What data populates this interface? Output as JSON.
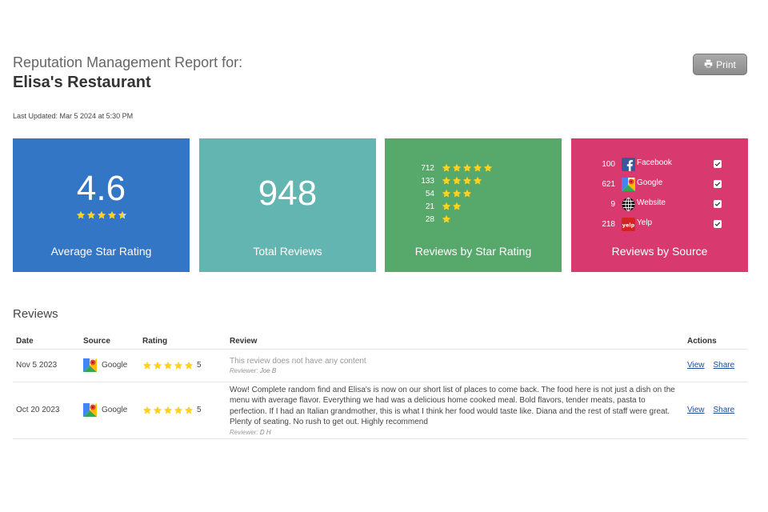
{
  "header": {
    "subtitle": "Reputation Management Report for:",
    "title": "Elisa's Restaurant",
    "print_label": "Print",
    "last_updated": "Last Updated: Mar 5 2024 at 5:30 PM"
  },
  "tiles": {
    "average": {
      "value": "4.6",
      "label": "Average Star Rating",
      "stars": 4.6
    },
    "total": {
      "value": "948",
      "label": "Total Reviews"
    },
    "by_star": {
      "label": "Reviews by Star Rating",
      "rows": [
        {
          "count": "712",
          "stars": 5
        },
        {
          "count": "133",
          "stars": 4
        },
        {
          "count": "54",
          "stars": 3
        },
        {
          "count": "21",
          "stars": 2
        },
        {
          "count": "28",
          "stars": 1
        }
      ]
    },
    "by_source": {
      "label": "Reviews by Source",
      "rows": [
        {
          "count": "100",
          "name": "Facebook",
          "icon": "facebook-icon",
          "checked": true
        },
        {
          "count": "621",
          "name": "Google",
          "icon": "google-maps-icon",
          "checked": true
        },
        {
          "count": "9",
          "name": "Website",
          "icon": "globe-icon",
          "checked": true
        },
        {
          "count": "218",
          "name": "Yelp",
          "icon": "yelp-icon",
          "checked": true
        }
      ]
    }
  },
  "reviews": {
    "heading": "Reviews",
    "columns": {
      "date": "Date",
      "source": "Source",
      "rating": "Rating",
      "review": "Review",
      "actions": "Actions"
    },
    "reviewer_label": "Reviewer:",
    "view_label": "View",
    "share_label": "Share",
    "rows": [
      {
        "date": "Nov 5 2023",
        "source": "Google",
        "rating": "5",
        "text": "This review does not have any content",
        "reviewer": "Joe B"
      },
      {
        "date": "Oct 20 2023",
        "source": "Google",
        "rating": "5",
        "text": "Wow! Complete random find and Elisa's is now on our short list of places to come back. The food here is not just a dish on the menu with average flavor. Everything we had was a delicious home cooked meal. Bold flavors, tender meats, pasta to perfection. If I had an Italian grandmother, this is what I think her food would taste like. Diana and the rest of staff were great. Plenty of seating. No rush to get out. Highly recommend",
        "reviewer": "D H"
      }
    ]
  },
  "colors": {
    "tile_average": "#3476c6",
    "tile_total": "#62b5b0",
    "tile_by_star": "#56a86b",
    "tile_by_source": "#d83a6f",
    "star": "#ffd21f",
    "link": "#1a4c9c"
  }
}
